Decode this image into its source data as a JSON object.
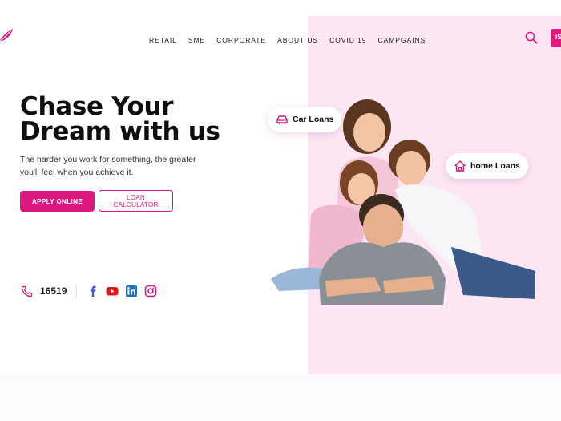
{
  "header": {
    "nav": [
      "RETAIL",
      "SME",
      "CORPORATE",
      "ABOUT US",
      "COVID 19",
      "CAMPGAINS"
    ],
    "lang_label": "IS"
  },
  "hero": {
    "title_line1": "Chase Your",
    "title_line2": "Dream with us",
    "subtitle": "The harder you work for something, the greater you'll feel when you achieve it.",
    "apply_label": "APPLY ONLINE",
    "calc_label": "LOAN CALCULATOR"
  },
  "contact": {
    "hotline": "16519",
    "social": [
      "facebook-icon",
      "youtube-icon",
      "linkedin-icon",
      "instagram-icon"
    ]
  },
  "badges": {
    "car_loans": "Car Loans",
    "home_loans": "home Loans"
  },
  "colors": {
    "brand": "#dc1780",
    "panel": "#fde6f4"
  }
}
